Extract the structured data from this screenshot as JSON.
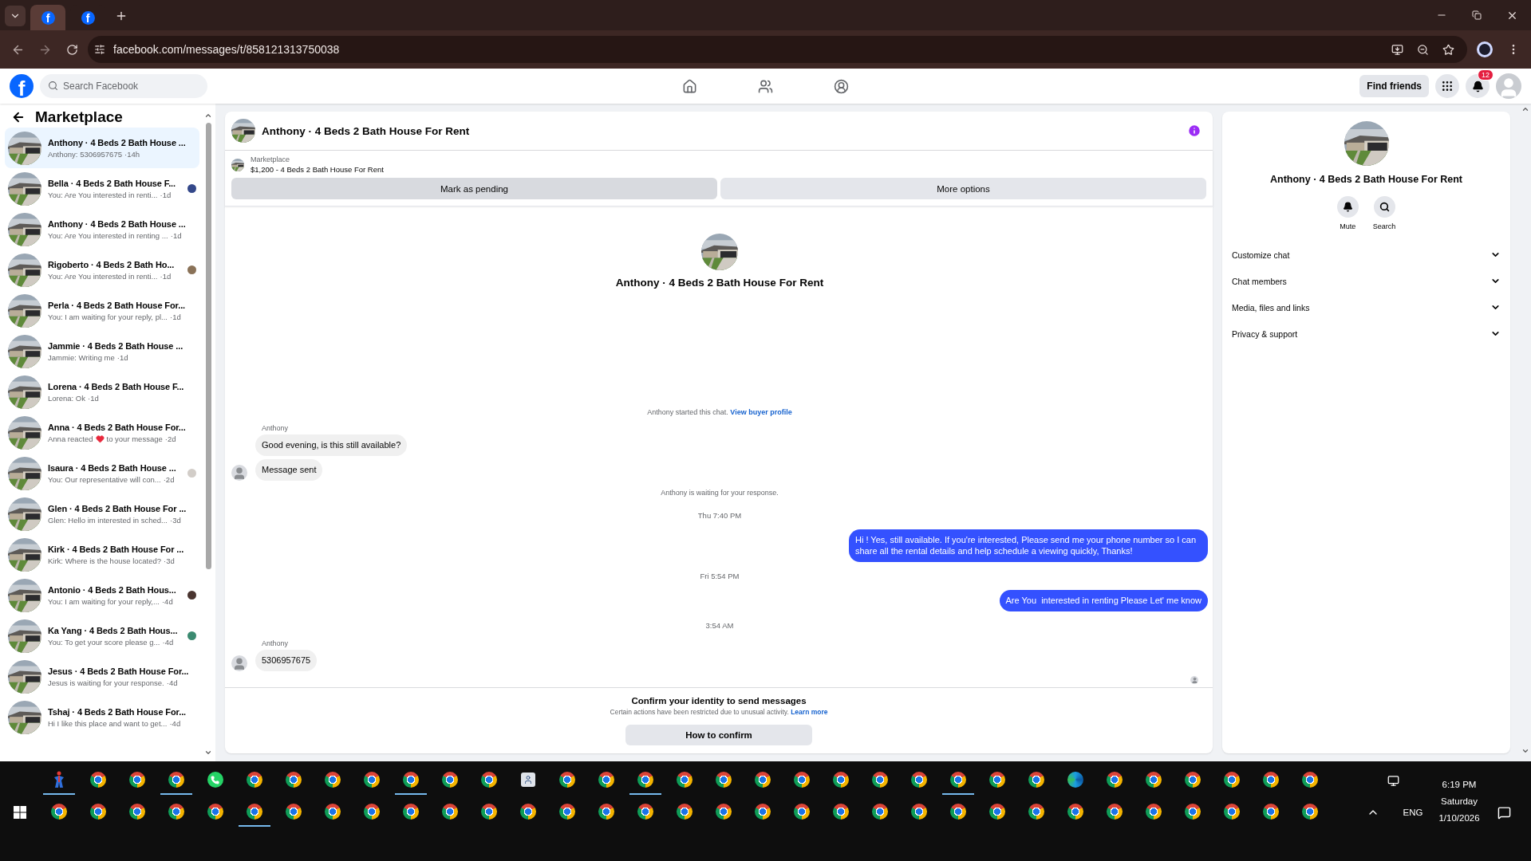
{
  "browser": {
    "tabs": [
      {
        "favicon": "f",
        "selected": true
      },
      {
        "favicon": "f",
        "selected": false
      }
    ],
    "url": "facebook.com/messages/t/858121313750038"
  },
  "header": {
    "logo": "f",
    "search": {
      "placeholder": "Search Facebook"
    },
    "find_friends": "Find friends",
    "notification_count": "12"
  },
  "sidebar": {
    "title": "Marketplace",
    "conversations": [
      {
        "title": "Anthony · 4 Beds 2 Bath House ...",
        "preview": "Anthony: 5306957675",
        "time": "·14h",
        "selected": true
      },
      {
        "title": "Bella · 4 Beds 2 Bath House F...",
        "preview": "You: Are You interested in renti...",
        "time": "·1d",
        "selected": false,
        "color": "#34488a"
      },
      {
        "title": "Anthony · 4 Beds 2 Bath House ...",
        "preview": "You: Are You interested in renting ...",
        "time": "·1d",
        "selected": false
      },
      {
        "title": "Rigoberto · 4 Beds 2 Bath Ho...",
        "preview": "You: Are You interested in renti...",
        "time": "·1d",
        "selected": false,
        "color": "#8a7258"
      },
      {
        "title": "Perla · 4 Beds 2 Bath House For...",
        "preview": "You: I am waiting for your reply, pl...",
        "time": "·1d",
        "selected": false
      },
      {
        "title": "Jammie · 4 Beds 2 Bath House ...",
        "preview": "Jammie: Writing me",
        "time": "·1d",
        "selected": false
      },
      {
        "title": "Lorena · 4 Beds 2 Bath House F...",
        "preview": "Lorena: Ok",
        "time": "·1d",
        "selected": false
      },
      {
        "title": "Anna · 4 Beds 2 Bath House For...",
        "preview": "Anna reacted",
        "reacted": true,
        "preview_end": "to your message",
        "time": "·2d",
        "selected": false
      },
      {
        "title": "Isaura · 4 Beds 2 Bath House ...",
        "preview": "You: Our representative will con...",
        "time": "·2d",
        "selected": false,
        "color": "#d2cdc8"
      },
      {
        "title": "Glen · 4 Beds 2 Bath House For ...",
        "preview": "Glen: Hello im interested in sched...",
        "time": "·3d",
        "selected": false
      },
      {
        "title": "Kirk · 4 Beds 2 Bath House For ...",
        "preview": "Kirk: Where is the house located?",
        "time": "·3d",
        "selected": false
      },
      {
        "title": "Antonio · 4 Beds 2 Bath Hous...",
        "preview": "You: I am waiting for your reply,...",
        "time": "·4d",
        "selected": false,
        "color": "#4a3530"
      },
      {
        "title": "Ka Yang · 4 Beds 2 Bath Hous...",
        "preview": "You: To get your score please g...",
        "time": "·4d",
        "selected": false,
        "color": "#3b8a70"
      },
      {
        "title": "Jesus · 4 Beds 2 Bath House For...",
        "preview": "Jesus is waiting for your response.",
        "time": "·4d",
        "selected": false
      },
      {
        "title": "Tshaj · 4 Beds 2 Bath House For...",
        "preview": "Hi I like this place and want to get...",
        "time": "·4d",
        "selected": false
      }
    ]
  },
  "chat": {
    "title": "Anthony · 4 Beds 2 Bath House For Rent",
    "listing": {
      "label": "Marketplace",
      "name": "$1,200 - 4 Beds 2 Bath House For Rent"
    },
    "actions": [
      {
        "label": "Mark as pending",
        "selected": true
      },
      {
        "label": "More options",
        "selected": false
      }
    ],
    "intro_title": "Anthony · 4 Beds 2 Bath House For Rent",
    "messages": [
      {
        "kind": "notice",
        "text": "Anthony started this chat.",
        "link": "View buyer profile"
      },
      {
        "kind": "incoming",
        "sender": "Anthony",
        "bubbles": [
          "Good evening, is this still available?",
          "Message sent"
        ]
      },
      {
        "kind": "notice",
        "text": "Anthony is waiting for your response."
      },
      {
        "kind": "time",
        "text": "Thu 7:40 PM"
      },
      {
        "kind": "outgoing",
        "text": "Hi ! Yes, still available. If you're interested, Please send me your phone number so I can share all the rental details and help schedule a viewing quickly, Thanks!"
      },
      {
        "kind": "time",
        "text": "Fri 5:54 PM"
      },
      {
        "kind": "outgoing",
        "text": "Are You  interested in renting Please Let' me know"
      },
      {
        "kind": "time",
        "text": "3:54 AM"
      },
      {
        "kind": "incoming",
        "sender": "Anthony",
        "bubbles": [
          "5306957675"
        ]
      }
    ],
    "seen_indicator": true,
    "restriction": {
      "title": "Confirm your identity to send messages",
      "text": "Certain actions have been restricted due to unusual activity.",
      "link": "Learn more",
      "button": "How to confirm"
    }
  },
  "details": {
    "title": "Anthony · 4 Beds 2 Bath House For Rent",
    "actions": [
      {
        "kind": "mute",
        "label": "Mute"
      },
      {
        "kind": "search",
        "label": "Search"
      }
    ],
    "sections": [
      {
        "label": "Customize chat",
        "expanded": false
      },
      {
        "label": "Chat members",
        "expanded": false
      },
      {
        "label": "Media, files and links",
        "expanded": false
      },
      {
        "label": "Privacy & support",
        "expanded": false
      }
    ]
  },
  "taskbar": {
    "rows": [
      [
        {
          "kind": "tool",
          "active": true
        },
        {
          "kind": "chrome",
          "active": false
        },
        {
          "kind": "chrome",
          "active": false
        },
        {
          "kind": "chrome",
          "active": true
        },
        {
          "kind": "whatsapp",
          "active": false
        },
        {
          "kind": "chrome",
          "active": false
        },
        {
          "kind": "chrome",
          "active": false
        },
        {
          "kind": "chrome",
          "active": false
        },
        {
          "kind": "chrome",
          "active": false
        },
        {
          "kind": "chrome",
          "active": true
        },
        {
          "kind": "chrome",
          "active": false
        },
        {
          "kind": "chrome",
          "active": false
        },
        {
          "kind": "contacts",
          "active": false
        },
        {
          "kind": "chrome",
          "active": false
        },
        {
          "kind": "chrome",
          "active": false
        },
        {
          "kind": "chrome",
          "active": true
        },
        {
          "kind": "chrome",
          "active": false
        },
        {
          "kind": "chrome",
          "active": false
        },
        {
          "kind": "chrome",
          "active": false
        },
        {
          "kind": "chrome",
          "active": false
        },
        {
          "kind": "chrome",
          "active": false
        },
        {
          "kind": "chrome",
          "active": false
        },
        {
          "kind": "chrome",
          "active": false
        },
        {
          "kind": "chrome",
          "active": true
        },
        {
          "kind": "chrome",
          "active": false
        },
        {
          "kind": "chrome",
          "active": false
        },
        {
          "kind": "edge",
          "active": false
        },
        {
          "kind": "chrome",
          "active": false
        },
        {
          "kind": "chrome",
          "active": false
        },
        {
          "kind": "chrome",
          "active": false
        },
        {
          "kind": "chrome",
          "active": false
        },
        {
          "kind": "chrome",
          "active": false
        },
        {
          "kind": "chrome",
          "active": false
        }
      ],
      [
        {
          "kind": "chrome",
          "active": false
        },
        {
          "kind": "chrome",
          "active": false
        },
        {
          "kind": "chrome",
          "active": false
        },
        {
          "kind": "chrome",
          "active": false
        },
        {
          "kind": "chrome",
          "active": false
        },
        {
          "kind": "chrome",
          "active": true
        },
        {
          "kind": "chrome",
          "active": false
        },
        {
          "kind": "chrome",
          "active": false
        },
        {
          "kind": "chrome",
          "active": false
        },
        {
          "kind": "chrome",
          "active": false
        },
        {
          "kind": "chrome",
          "active": false
        },
        {
          "kind": "chrome",
          "active": false
        },
        {
          "kind": "chrome",
          "active": false
        },
        {
          "kind": "chrome",
          "active": false
        },
        {
          "kind": "chrome",
          "active": false
        },
        {
          "kind": "chrome",
          "active": false
        },
        {
          "kind": "chrome",
          "active": false
        },
        {
          "kind": "chrome",
          "active": false
        },
        {
          "kind": "chrome",
          "active": false
        },
        {
          "kind": "chrome",
          "active": false
        },
        {
          "kind": "chrome",
          "active": false
        },
        {
          "kind": "chrome",
          "active": false
        },
        {
          "kind": "chrome",
          "active": false
        },
        {
          "kind": "chrome",
          "active": false
        },
        {
          "kind": "chrome",
          "active": false
        },
        {
          "kind": "chrome",
          "active": false
        },
        {
          "kind": "chrome",
          "active": false
        },
        {
          "kind": "chrome",
          "active": false
        },
        {
          "kind": "chrome",
          "active": false
        },
        {
          "kind": "chrome",
          "active": false
        },
        {
          "kind": "chrome",
          "active": false
        },
        {
          "kind": "chrome",
          "active": false
        },
        {
          "kind": "chrome",
          "active": false
        }
      ]
    ],
    "language": "ENG",
    "time": "6:19 PM",
    "day": "Saturday",
    "date": "1/10/2026"
  }
}
